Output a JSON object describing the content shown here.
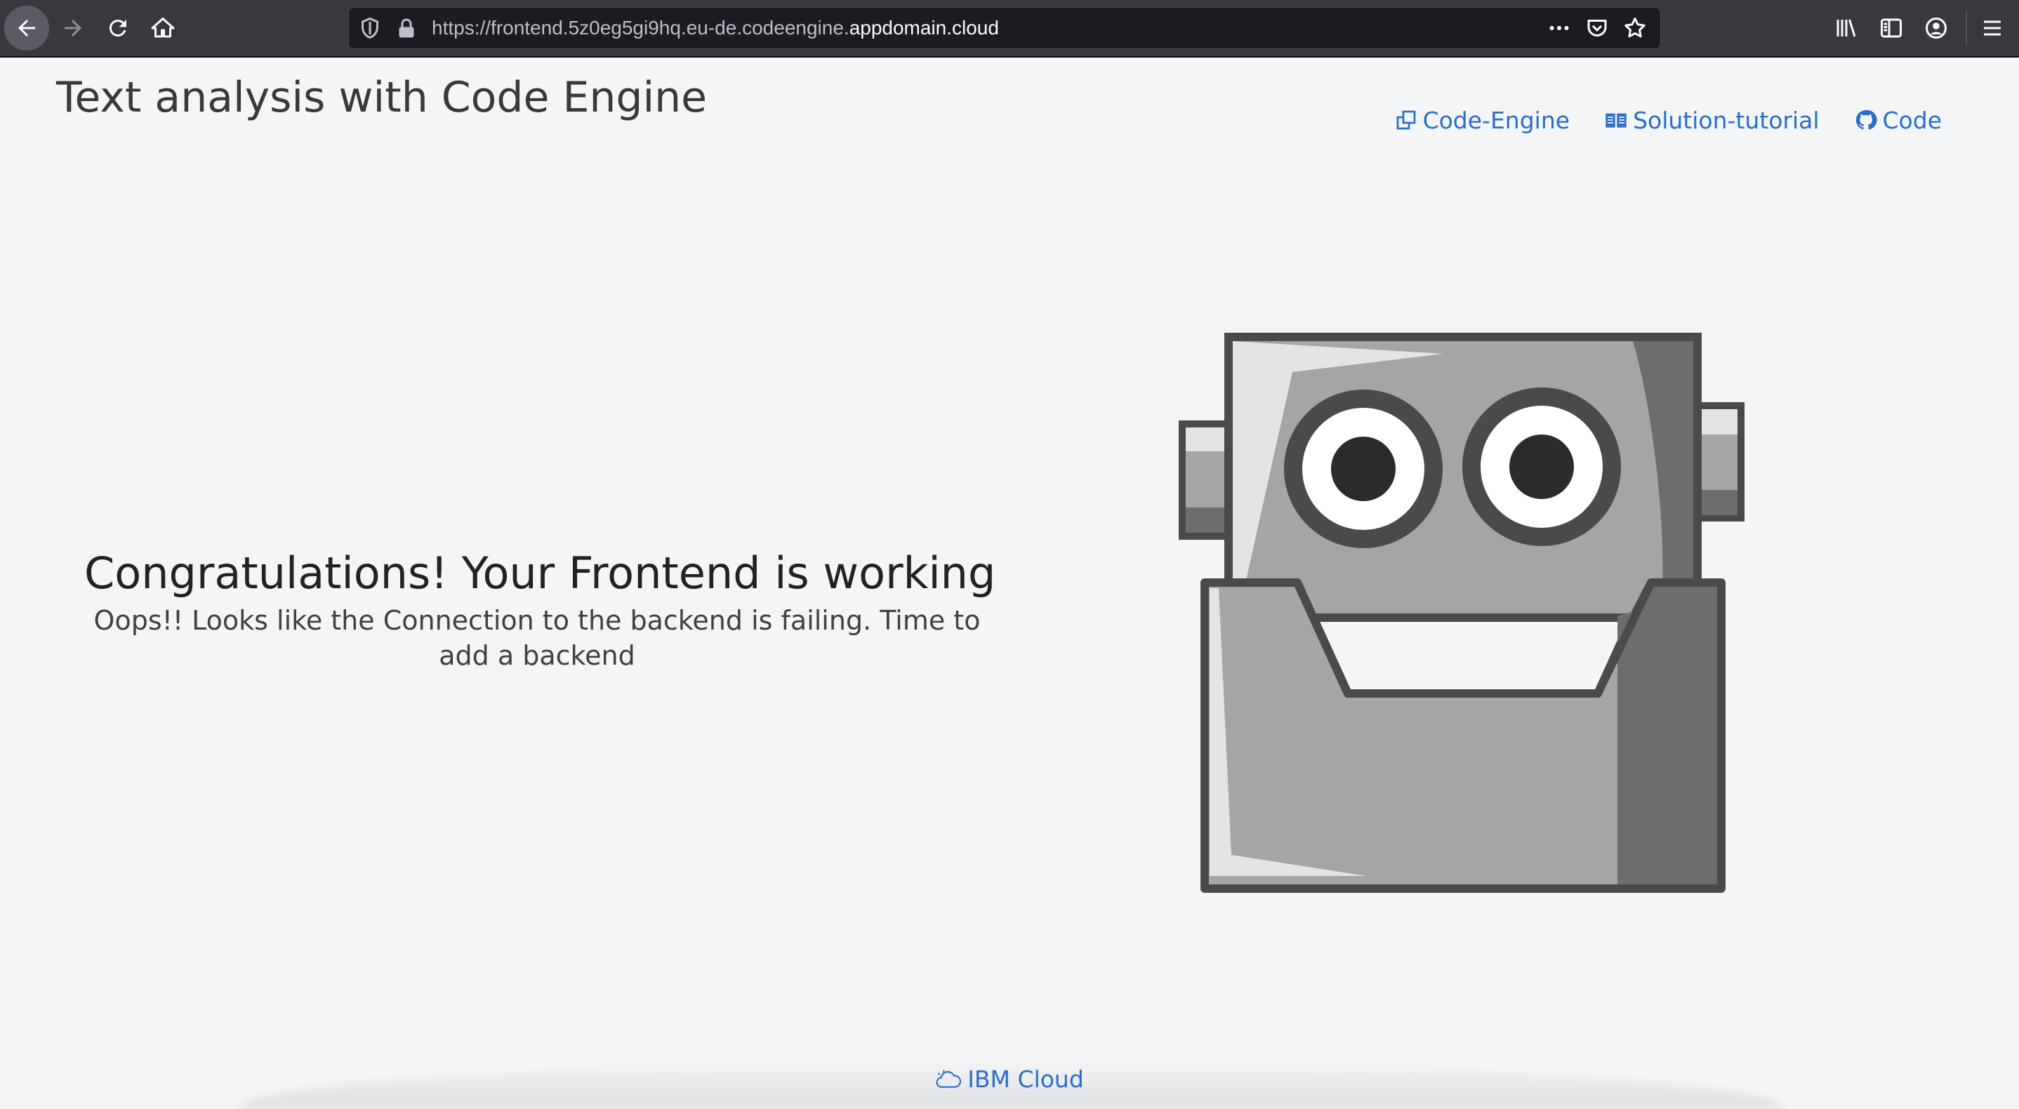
{
  "browser": {
    "url_prefix": "https://frontend.5z0eg5gi9hq.eu-de.codeengine.",
    "url_domain": "appdomain.cloud",
    "icons": [
      "back-icon",
      "forward-icon",
      "reload-icon",
      "home-icon",
      "shield-icon",
      "lock-icon",
      "more-icon",
      "pocket-icon",
      "bookmark-star-icon",
      "library-icon",
      "sidebar-icon",
      "account-icon",
      "menu-icon"
    ]
  },
  "header": {
    "title": "Text analysis with Code Engine",
    "links": [
      {
        "label": "Code-Engine",
        "icon": "launch-icon"
      },
      {
        "label": "Solution-tutorial",
        "icon": "book-icon"
      },
      {
        "label": "Code",
        "icon": "github-icon"
      }
    ]
  },
  "main": {
    "heading": "Congratulations! Your Frontend is working",
    "subtext": "Oops!! Looks like the Connection to the backend is failing. Time to add a backend"
  },
  "colors": {
    "link": "#2a6ec9",
    "robot_body": "#a5a5a5",
    "robot_dark": "#6d6d6d",
    "robot_outline": "#4a4a4a",
    "robot_light": "#e4e4e4",
    "eye_pupil": "#2b2b2b"
  },
  "footer": {
    "label": "IBM Cloud",
    "icon": "cloud-icon"
  }
}
